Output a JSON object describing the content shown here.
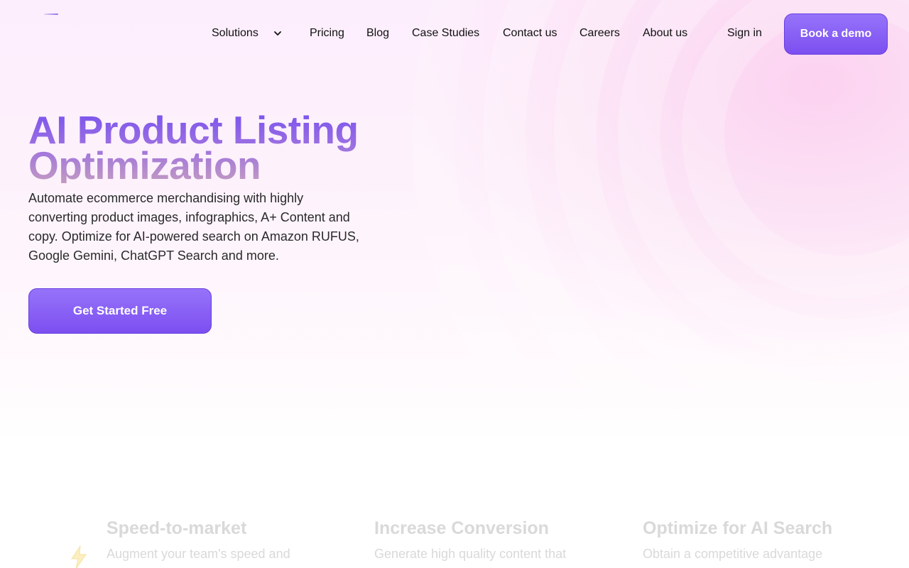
{
  "header": {
    "nav": [
      {
        "label": "Solutions"
      },
      {
        "label": "Pricing"
      },
      {
        "label": "Blog"
      },
      {
        "label": "Case Studies"
      },
      {
        "label": "Contact us"
      },
      {
        "label": "Careers"
      },
      {
        "label": "About us"
      }
    ],
    "sign_in": "Sign in",
    "book_demo": "Book a demo"
  },
  "hero": {
    "title_line1": "AI Product Listing",
    "title_line2": "Optimization",
    "subtitle": "Automate ecommerce merchandising with highly converting product images, infographics, A+ Content and copy. Optimize for AI-powered search on Amazon RUFUS, Google Gemini, ChatGPT Search and more.",
    "cta": "Get Started Free"
  },
  "features": [
    {
      "title": "Speed-to-market",
      "desc": "Augment your team's speed and",
      "icon": "lightning-icon"
    },
    {
      "title": "Increase Conversion",
      "desc": "Generate high quality content that"
    },
    {
      "title": "Optimize for AI Search",
      "desc": "Obtain a competitive advantage"
    }
  ],
  "colors": {
    "accent": "#7c4ff0",
    "accent_light": "#9673fa",
    "title_gradient_end": "#c29ac2",
    "muted": "#d9d9d9"
  }
}
